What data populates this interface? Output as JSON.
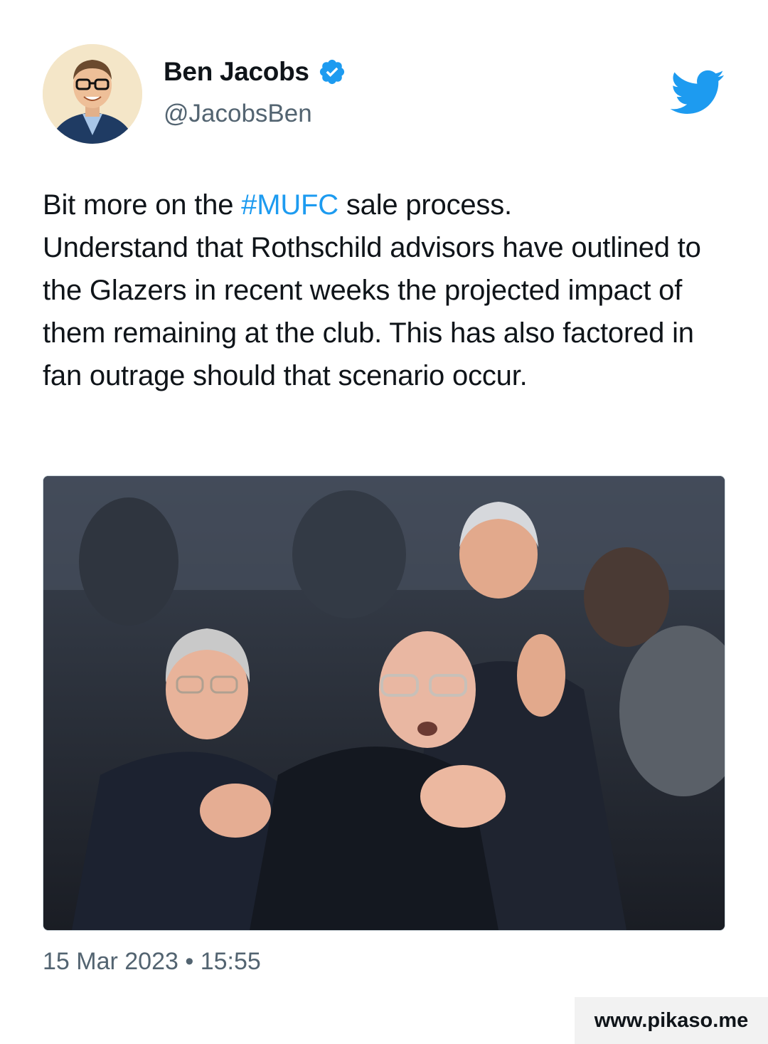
{
  "author": {
    "display_name": "Ben Jacobs",
    "handle": "@JacobsBen",
    "verified": true,
    "avatar_icon": "profile-photo",
    "verified_icon": "verified-badge-icon"
  },
  "platform_icon": "twitter-bird-icon",
  "tweet": {
    "line1_before": "Bit more on the ",
    "hashtag": "#MUFC",
    "line1_after": " sale process.",
    "body": "Understand that Rothschild advisors have outlined to the Glazers in recent weeks the projected impact of them remaining at the club. This has also factored in fan outrage should that scenario occur."
  },
  "media": {
    "kind": "photo"
  },
  "timestamp": "15 Mar 2023 • 15:55",
  "watermark": "www.pikaso.me",
  "colors": {
    "accent": "#1d9bf0",
    "text": "#0f1419",
    "secondary": "#536471"
  }
}
